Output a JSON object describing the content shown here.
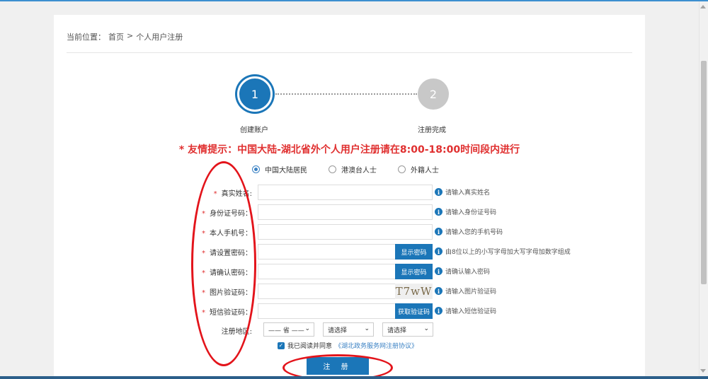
{
  "breadcrumb": {
    "prefix": "当前位置：",
    "home": "首页",
    "separator": ">",
    "current": "个人用户注册"
  },
  "steps": [
    {
      "number": "1",
      "label": "创建账户"
    },
    {
      "number": "2",
      "label": "注册完成"
    }
  ],
  "notice": "* 友情提示：中国大陆-湖北省外个人用户注册请在8:00-18:00时间段内进行",
  "identity_options": [
    {
      "label": "中国大陆居民",
      "checked": true
    },
    {
      "label": "港澳台人士",
      "checked": false
    },
    {
      "label": "外籍人士",
      "checked": false
    }
  ],
  "fields": [
    {
      "label": "真实姓名:",
      "hint": "请输入真实姓名"
    },
    {
      "label": "身份证号码：",
      "hint": "请输入身份证号码"
    },
    {
      "label": "本人手机号：",
      "hint": "请输入您的手机号码"
    },
    {
      "label": "请设置密码：",
      "button": "显示密码",
      "hint": "由8位以上的小写字母加大写字母加数字组成"
    },
    {
      "label": "请确认密码：",
      "button": "显示密码",
      "hint": "请确认输入密码"
    },
    {
      "label": "图片验证码：",
      "captcha": "T7wW",
      "hint": "请输入图片验证码"
    },
    {
      "label": "短信验证码：",
      "button": "获取验证码",
      "hint": "请输入短信验证码"
    }
  ],
  "required_mark": "*",
  "info_icon_glyph": "i",
  "region": {
    "label": "注册地区:",
    "province": "—— 省 ——",
    "city": "请选择",
    "district": "请选择"
  },
  "agreement": {
    "text": "我已阅读并同意",
    "link": "《湖北政务服务网注册协议》",
    "checked": true
  },
  "submit_label": "注 册",
  "colors": {
    "primary": "#1b76b8",
    "notice": "#e03030",
    "annotation": "#e3141b"
  }
}
